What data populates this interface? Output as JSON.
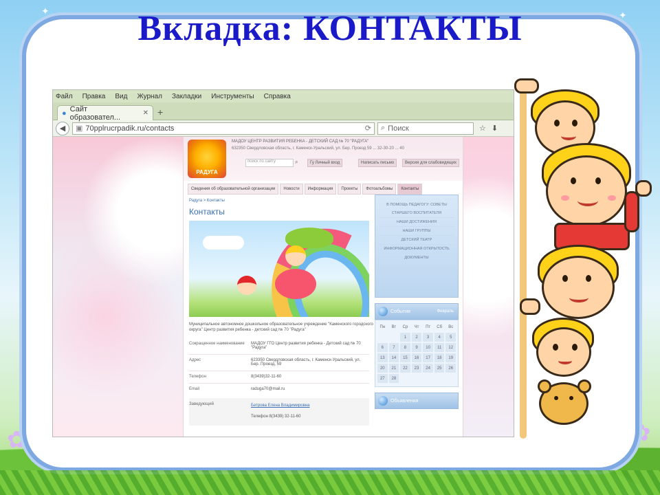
{
  "slide": {
    "title": "Вкладка: КОНТАКТЫ"
  },
  "browser": {
    "menu": [
      "Файл",
      "Правка",
      "Вид",
      "Журнал",
      "Закладки",
      "Инструменты",
      "Справка"
    ],
    "tab_title": "Сайт образовател...",
    "url": "70pplrucrpadik.ru/contacts",
    "search_placeholder": "Поиск"
  },
  "site": {
    "org_name": "МАДОУ ЦЕНТР РАЗВИТИЯ РЕБЕНКА - ДЕТСКИЙ САД № 70 \"РАДУГА\"",
    "address": "632350 Свердловская область, г. Каменск-Уральский, ул. Бер. Проезд 59 ... 32-30-20 ... 40",
    "logo_text": "РАДУГА",
    "search_placeholder": "поиск по сайту",
    "header_buttons": [
      "Гу Личный вход",
      "Написать письмо",
      "Версия для слабовидящих"
    ],
    "nav": [
      "Сведения об образовательной организации",
      "Новости",
      "Информация",
      "Проекты",
      "Фотоальбомы",
      "Контакты"
    ],
    "breadcrumb": "Радуга > Контакты",
    "page_title": "Контакты",
    "intro_line1": "Муниципальное автономное дошкольное образовательное учреждение \"Каменского городского",
    "intro_line2": "округа\" Центр развития ребенка - детский сад № 70 \"Радуга\"",
    "fields": [
      {
        "label": "Сокращенное наименование",
        "value": "МАДОУ ГГО Центр развития ребенка - Детский сад № 70 \"Радуга\""
      },
      {
        "label": "Адрес",
        "value": "623350 Свердловская область, г. Каменск-Уральский, ул. Бер. Проезд, 59"
      },
      {
        "label": "Телефон",
        "value": "8(3439)32-11-60"
      },
      {
        "label": "Email",
        "value": "raduga70@mail.ru"
      }
    ],
    "head_label": "Заведующий",
    "head_name": "Бетрова Елена Владимировна",
    "head_phone": "Телефон 8(3439) 32-11-60"
  },
  "sidebar": {
    "menu": [
      "В ПОМОЩЬ ПЕДАГОГУ: СОВЕТЫ СТАРШЕГО ВОСПИТАТЕЛЯ",
      "НАШИ ДОСТИЖЕНИЯ",
      "НАШИ ГРУППЫ",
      "ДЕТСКИЙ ТЕАТР",
      "ИНФОРМАЦИОННАЯ ОТКРЫТОСТЬ",
      "ДОКУМЕНТЫ"
    ],
    "events_title": "События",
    "month": "Февраль",
    "weekdays": [
      "Пн",
      "Вт",
      "Ср",
      "Чт",
      "Пт",
      "Сб",
      "Вс"
    ],
    "calendar": [
      [
        "",
        "",
        "1",
        "2",
        "3",
        "4",
        "5"
      ],
      [
        "6",
        "7",
        "8",
        "9",
        "10",
        "11",
        "12"
      ],
      [
        "13",
        "14",
        "15",
        "16",
        "17",
        "18",
        "19"
      ],
      [
        "20",
        "21",
        "22",
        "23",
        "24",
        "25",
        "26"
      ],
      [
        "27",
        "28",
        "",
        "",
        "",
        "",
        ""
      ]
    ],
    "ads_title": "Объявления"
  }
}
